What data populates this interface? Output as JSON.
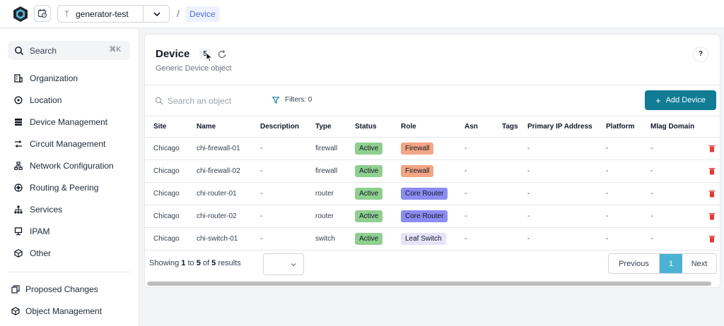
{
  "topbar": {
    "branch": "generator-test",
    "breadcrumb_sep": "/",
    "breadcrumb": "Device"
  },
  "sidebar": {
    "search_label": "Search",
    "search_shortcut": "⌘K",
    "items": [
      {
        "label": "Organization",
        "icon": "building-icon"
      },
      {
        "label": "Location",
        "icon": "location-pin-icon"
      },
      {
        "label": "Device Management",
        "icon": "server-icon"
      },
      {
        "label": "Circuit Management",
        "icon": "circuit-icon"
      },
      {
        "label": "Network Configuration",
        "icon": "network-icon"
      },
      {
        "label": "Routing & Peering",
        "icon": "routing-icon"
      },
      {
        "label": "Services",
        "icon": "hierarchy-icon"
      },
      {
        "label": "IPAM",
        "icon": "monitor-icon"
      },
      {
        "label": "Other",
        "icon": "cube-icon"
      }
    ],
    "bottom_items": [
      {
        "label": "Proposed Changes",
        "icon": "document-copy-icon"
      },
      {
        "label": "Object Management",
        "icon": "cube-icon"
      }
    ]
  },
  "main": {
    "title": "Device",
    "count": "5",
    "subtitle": "Generic Device object",
    "help": "?",
    "search_placeholder": "Search an object",
    "filters_label": "Filters: 0",
    "add_button": "Add Device",
    "columns": [
      "Site",
      "Name",
      "Description",
      "Type",
      "Status",
      "Role",
      "Asn",
      "Tags",
      "Primary IP Address",
      "Platform",
      "Mlag Domain"
    ],
    "rows": [
      {
        "site": "Chicago",
        "name": "chi-firewall-01",
        "description": "-",
        "type": "firewall",
        "status": "Active",
        "role": "Firewall",
        "asn": "-",
        "tags": "",
        "primary_ip": "-",
        "platform": "-",
        "mlag": "-"
      },
      {
        "site": "Chicago",
        "name": "chi-firewall-02",
        "description": "-",
        "type": "firewall",
        "status": "Active",
        "role": "Firewall",
        "asn": "-",
        "tags": "",
        "primary_ip": "-",
        "platform": "-",
        "mlag": "-"
      },
      {
        "site": "Chicago",
        "name": "chi-router-01",
        "description": "-",
        "type": "router",
        "status": "Active",
        "role": "Core Router",
        "asn": "-",
        "tags": "",
        "primary_ip": "-",
        "platform": "-",
        "mlag": "-"
      },
      {
        "site": "Chicago",
        "name": "chi-router-02",
        "description": "-",
        "type": "router",
        "status": "Active",
        "role": "Core Router",
        "asn": "-",
        "tags": "",
        "primary_ip": "-",
        "platform": "-",
        "mlag": "-"
      },
      {
        "site": "Chicago",
        "name": "chi-switch-01",
        "description": "-",
        "type": "switch",
        "status": "Active",
        "role": "Leaf Switch",
        "asn": "-",
        "tags": "",
        "primary_ip": "-",
        "platform": "-",
        "mlag": "-"
      }
    ],
    "colors": {
      "status_active": "#8fcf8f",
      "role_firewall": "#f4a584",
      "role_core_router": "#8b8cf2",
      "role_leaf_switch": "#e6e3f8",
      "accent": "#117c93",
      "trash": "#e53935"
    }
  },
  "footer": {
    "showing_prefix": "Showing",
    "from": "1",
    "to_word": "to",
    "to": "5",
    "of_word": "of",
    "total": "5",
    "results_word": "results",
    "previous": "Previous",
    "current_page": "1",
    "next": "Next"
  }
}
